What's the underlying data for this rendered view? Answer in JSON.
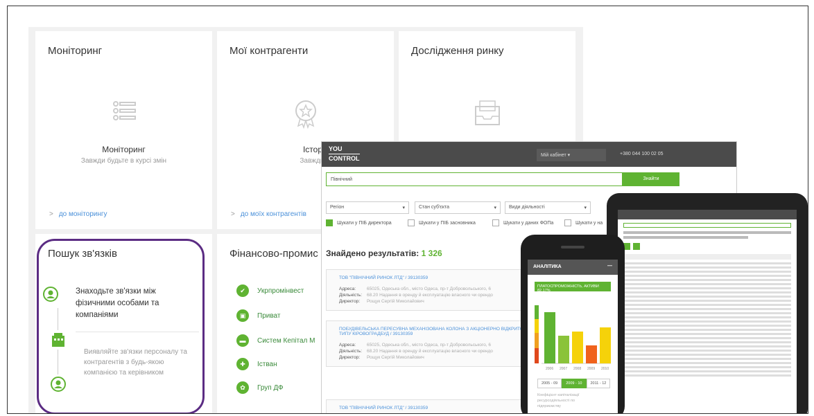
{
  "dashboard": {
    "cards": {
      "monitoring": {
        "title": "Моніторинг",
        "big": "Моніторинг",
        "small": "Завжди будьте в курсі змін",
        "link": "до моніторингу"
      },
      "counterparties": {
        "title": "Мої контрагенти",
        "big": "Історія пере",
        "small": "Завжди будьте в",
        "link": "до моїх контрагентів"
      },
      "research": {
        "title": "Дослідження ринку"
      },
      "relations": {
        "title": "Пошук зв'язків",
        "text1": "Знаходьте зв'язки між фізичними особами та компаніями",
        "text2": "Виявляйте зв'язки персоналу та контрагентів з будь-якою компанією та керівником"
      },
      "finance": {
        "title": "Фінансово-промис",
        "items": [
          "Укрпромінвест",
          "Приват",
          "Систем Кепітал М",
          "Істван",
          "Груп ДФ"
        ]
      }
    }
  },
  "desktop": {
    "logo_top": "YOU",
    "logo_bottom": "CONTROL",
    "cabinet": "Мій кабінет",
    "phone": "+380 044 100 02 05",
    "search_value": "Північний",
    "search_button": "Знайти",
    "selects": [
      "Регіон",
      "Стан суб'єкта",
      "Види діяльності"
    ],
    "checkboxes": [
      "Шукати у ПІБ директора",
      "Шукати у ПІБ засновника",
      "Шукати у даних ФОПа",
      "Шукати у на"
    ],
    "found_label": "Знайдено результатів:",
    "found_count": "1 326",
    "results": [
      {
        "title": "ТОВ \"ПІВНІЧНИЙ РИНОК ЛТД\" / 39130359",
        "address_label": "Адреса:",
        "address": "65025, Одеська обл., місто Одеса, пр-т Добровольського, 6",
        "activity_label": "Діяльність:",
        "activity": "68.20 Надання в оренду й експлуатацію власного чи орендо",
        "director_label": "Директор:",
        "director": "Рощук Сергій Миколайович"
      },
      {
        "title": "ПОБУДІВЕЛЬСЬКА ПЕРЕСУВНА МЕХАНІЗОВАНА КОЛОНА З АКЦІОНЕРНО ВІДКРИТОГО ТИПУ КІРОВОГРАДБУД / 39130359",
        "address_label": "Адреса:",
        "address": "65025, Одеська обл., місто Одеса, пр-т Добровольського, 6",
        "activity_label": "Діяльність:",
        "activity": "68.20 Надання в оренду й експлуатацію власного чи орендо",
        "director_label": "Директор:",
        "director": "Рощук Сергій Миколайович"
      },
      {
        "title": "ТОВ \"ПІВНІЧНИЙ РИНОК ЛТД\" / 39130359"
      }
    ]
  },
  "phone": {
    "header": "АНАЛІТИКА",
    "badge": "ПЛАТОСПРОМОЖНІСТЬ, АКТИВИ  82,17%",
    "years": [
      "2006",
      "2007",
      "2008",
      "2009",
      "2010"
    ],
    "tabs": [
      "2005 - 09",
      "2009 - 10",
      "2011 - 12"
    ],
    "foot": "Коефіцієнт капіталізації ресурсодіяльності по підприємству"
  },
  "colors": {
    "accent": "#5fb332",
    "highlight": "#5b2c83",
    "topbar": "#4b4b4b"
  }
}
